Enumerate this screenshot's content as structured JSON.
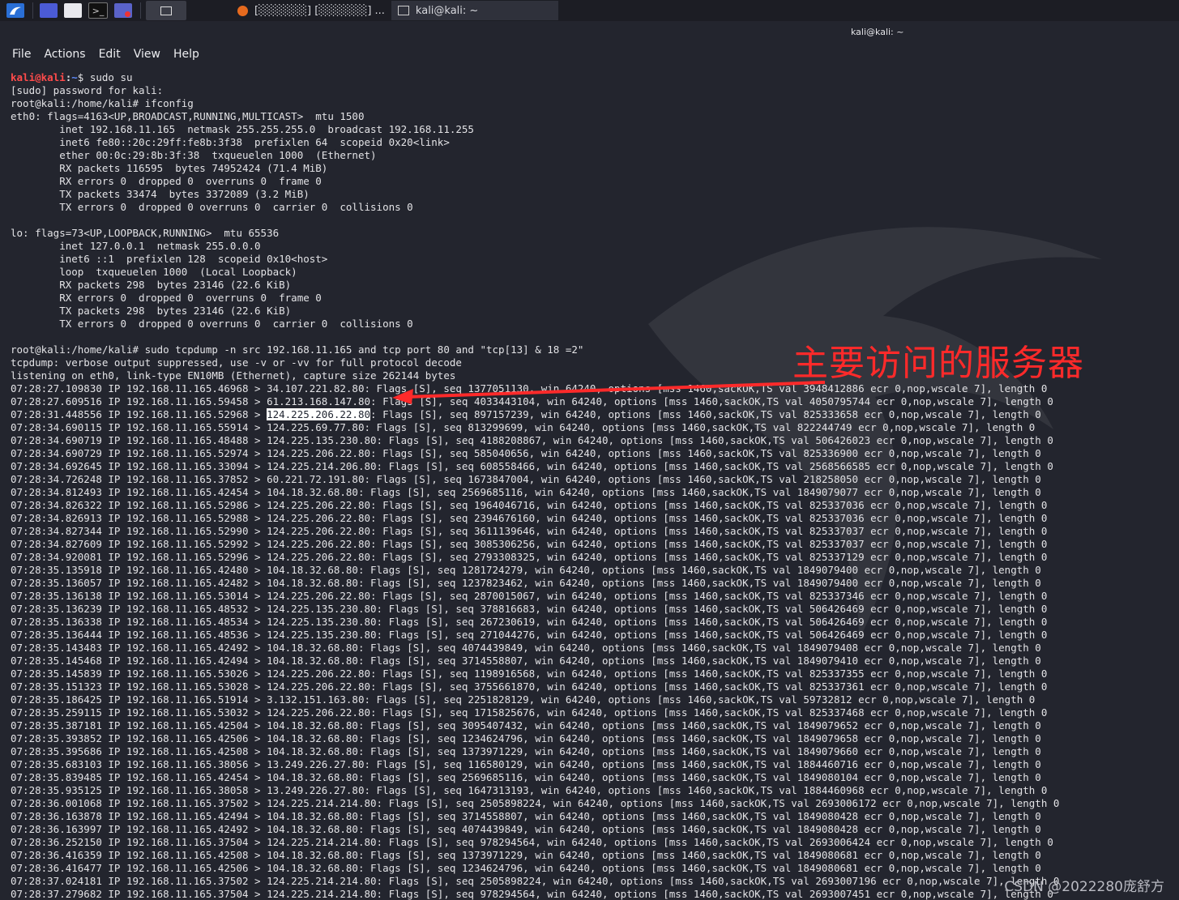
{
  "taskbar": {
    "tasks": [
      {
        "label": "[░░░░░░] [░░░░░░] ..."
      },
      {
        "label": "kali@kali: ~"
      }
    ]
  },
  "window": {
    "title": "kali@kali: ~"
  },
  "menu": [
    "File",
    "Actions",
    "Edit",
    "View",
    "Help"
  ],
  "prompt": {
    "user": "kali@kali",
    "path": "~",
    "command": "sudo su"
  },
  "terminal_lines": [
    "[sudo] password for kali:",
    "root@kali:/home/kali# ifconfig",
    "eth0: flags=4163<UP,BROADCAST,RUNNING,MULTICAST>  mtu 1500",
    "        inet 192.168.11.165  netmask 255.255.255.0  broadcast 192.168.11.255",
    "        inet6 fe80::20c:29ff:fe8b:3f38  prefixlen 64  scopeid 0x20<link>",
    "        ether 00:0c:29:8b:3f:38  txqueuelen 1000  (Ethernet)",
    "        RX packets 116595  bytes 74952424 (71.4 MiB)",
    "        RX errors 0  dropped 0  overruns 0  frame 0",
    "        TX packets 33474  bytes 3372089 (3.2 MiB)",
    "        TX errors 0  dropped 0 overruns 0  carrier 0  collisions 0",
    "",
    "lo: flags=73<UP,LOOPBACK,RUNNING>  mtu 65536",
    "        inet 127.0.0.1  netmask 255.0.0.0",
    "        inet6 ::1  prefixlen 128  scopeid 0x10<host>",
    "        loop  txqueuelen 1000  (Local Loopback)",
    "        RX packets 298  bytes 23146 (22.6 KiB)",
    "        RX errors 0  dropped 0  overruns 0  frame 0",
    "        TX packets 298  bytes 23146 (22.6 KiB)",
    "        TX errors 0  dropped 0 overruns 0  carrier 0  collisions 0",
    "",
    "root@kali:/home/kali# sudo tcpdump -n src 192.168.11.165 and tcp port 80 and \"tcp[13] & 18 =2\"",
    "tcpdump: verbose output suppressed, use -v or -vv for full protocol decode",
    "listening on eth0, link-type EN10MB (Ethernet), capture size 262144 bytes",
    "07:28:27.109830 IP 192.168.11.165.46968 > 34.107.221.82.80: Flags [S], seq 1377051130, win 64240, options [mss 1460,sackOK,TS val 3948412886 ecr 0,nop,wscale 7], length 0",
    "07:28:27.609516 IP 192.168.11.165.59458 > 61.213.168.147.80: Flags [S], seq 4033443104, win 64240, options [mss 1460,sackOK,TS val 4050795744 ecr 0,nop,wscale 7], length 0",
    "07:28:31.448556 IP 192.168.11.165.52968 > 124.225.206.22.80: Flags [S], seq 897157239, win 64240, options [mss 1460,sackOK,TS val 825333658 ecr 0,nop,wscale 7], length 0",
    "07:28:34.690115 IP 192.168.11.165.55914 > 124.225.69.77.80: Flags [S], seq 813299699, win 64240, options [mss 1460,sackOK,TS val 822244749 ecr 0,nop,wscale 7], length 0",
    "07:28:34.690719 IP 192.168.11.165.48488 > 124.225.135.230.80: Flags [S], seq 4188208867, win 64240, options [mss 1460,sackOK,TS val 506426023 ecr 0,nop,wscale 7], length 0",
    "07:28:34.690729 IP 192.168.11.165.52974 > 124.225.206.22.80: Flags [S], seq 585040656, win 64240, options [mss 1460,sackOK,TS val 825336900 ecr 0,nop,wscale 7], length 0",
    "07:28:34.692645 IP 192.168.11.165.33094 > 124.225.214.206.80: Flags [S], seq 608558466, win 64240, options [mss 1460,sackOK,TS val 2568566585 ecr 0,nop,wscale 7], length 0",
    "07:28:34.726248 IP 192.168.11.165.37852 > 60.221.72.191.80: Flags [S], seq 1673847004, win 64240, options [mss 1460,sackOK,TS val 218258050 ecr 0,nop,wscale 7], length 0",
    "07:28:34.812493 IP 192.168.11.165.42454 > 104.18.32.68.80: Flags [S], seq 2569685116, win 64240, options [mss 1460,sackOK,TS val 1849079077 ecr 0,nop,wscale 7], length 0",
    "07:28:34.826322 IP 192.168.11.165.52986 > 124.225.206.22.80: Flags [S], seq 1964046716, win 64240, options [mss 1460,sackOK,TS val 825337036 ecr 0,nop,wscale 7], length 0",
    "07:28:34.826913 IP 192.168.11.165.52988 > 124.225.206.22.80: Flags [S], seq 2394676160, win 64240, options [mss 1460,sackOK,TS val 825337036 ecr 0,nop,wscale 7], length 0",
    "07:28:34.827344 IP 192.168.11.165.52990 > 124.225.206.22.80: Flags [S], seq 3611139646, win 64240, options [mss 1460,sackOK,TS val 825337037 ecr 0,nop,wscale 7], length 0",
    "07:28:34.827609 IP 192.168.11.165.52992 > 124.225.206.22.80: Flags [S], seq 3085306256, win 64240, options [mss 1460,sackOK,TS val 825337037 ecr 0,nop,wscale 7], length 0",
    "07:28:34.920081 IP 192.168.11.165.52996 > 124.225.206.22.80: Flags [S], seq 2793308325, win 64240, options [mss 1460,sackOK,TS val 825337129 ecr 0,nop,wscale 7], length 0",
    "07:28:35.135918 IP 192.168.11.165.42480 > 104.18.32.68.80: Flags [S], seq 1281724279, win 64240, options [mss 1460,sackOK,TS val 1849079400 ecr 0,nop,wscale 7], length 0",
    "07:28:35.136057 IP 192.168.11.165.42482 > 104.18.32.68.80: Flags [S], seq 1237823462, win 64240, options [mss 1460,sackOK,TS val 1849079400 ecr 0,nop,wscale 7], length 0",
    "07:28:35.136138 IP 192.168.11.165.53014 > 124.225.206.22.80: Flags [S], seq 2870015067, win 64240, options [mss 1460,sackOK,TS val 825337346 ecr 0,nop,wscale 7], length 0",
    "07:28:35.136239 IP 192.168.11.165.48532 > 124.225.135.230.80: Flags [S], seq 378816683, win 64240, options [mss 1460,sackOK,TS val 506426469 ecr 0,nop,wscale 7], length 0",
    "07:28:35.136338 IP 192.168.11.165.48534 > 124.225.135.230.80: Flags [S], seq 267230619, win 64240, options [mss 1460,sackOK,TS val 506426469 ecr 0,nop,wscale 7], length 0",
    "07:28:35.136444 IP 192.168.11.165.48536 > 124.225.135.230.80: Flags [S], seq 271044276, win 64240, options [mss 1460,sackOK,TS val 506426469 ecr 0,nop,wscale 7], length 0",
    "07:28:35.143483 IP 192.168.11.165.42492 > 104.18.32.68.80: Flags [S], seq 4074439849, win 64240, options [mss 1460,sackOK,TS val 1849079408 ecr 0,nop,wscale 7], length 0",
    "07:28:35.145468 IP 192.168.11.165.42494 > 104.18.32.68.80: Flags [S], seq 3714558807, win 64240, options [mss 1460,sackOK,TS val 1849079410 ecr 0,nop,wscale 7], length 0",
    "07:28:35.145839 IP 192.168.11.165.53026 > 124.225.206.22.80: Flags [S], seq 1198916568, win 64240, options [mss 1460,sackOK,TS val 825337355 ecr 0,nop,wscale 7], length 0",
    "07:28:35.151323 IP 192.168.11.165.53028 > 124.225.206.22.80: Flags [S], seq 3755661870, win 64240, options [mss 1460,sackOK,TS val 825337361 ecr 0,nop,wscale 7], length 0",
    "07:28:35.186425 IP 192.168.11.165.51914 > 3.132.151.163.80: Flags [S], seq 2251828129, win 64240, options [mss 1460,sackOK,TS val 59732812 ecr 0,nop,wscale 7], length 0",
    "07:28:35.259115 IP 192.168.11.165.53032 > 124.225.206.22.80: Flags [S], seq 1715825676, win 64240, options [mss 1460,sackOK,TS val 825337468 ecr 0,nop,wscale 7], length 0",
    "07:28:35.387181 IP 192.168.11.165.42504 > 104.18.32.68.80: Flags [S], seq 3095407432, win 64240, options [mss 1460,sackOK,TS val 1849079652 ecr 0,nop,wscale 7], length 0",
    "07:28:35.393852 IP 192.168.11.165.42506 > 104.18.32.68.80: Flags [S], seq 1234624796, win 64240, options [mss 1460,sackOK,TS val 1849079658 ecr 0,nop,wscale 7], length 0",
    "07:28:35.395686 IP 192.168.11.165.42508 > 104.18.32.68.80: Flags [S], seq 1373971229, win 64240, options [mss 1460,sackOK,TS val 1849079660 ecr 0,nop,wscale 7], length 0",
    "07:28:35.683103 IP 192.168.11.165.38056 > 13.249.226.27.80: Flags [S], seq 116580129, win 64240, options [mss 1460,sackOK,TS val 1884460716 ecr 0,nop,wscale 7], length 0",
    "07:28:35.839485 IP 192.168.11.165.42454 > 104.18.32.68.80: Flags [S], seq 2569685116, win 64240, options [mss 1460,sackOK,TS val 1849080104 ecr 0,nop,wscale 7], length 0",
    "07:28:35.935125 IP 192.168.11.165.38058 > 13.249.226.27.80: Flags [S], seq 1647313193, win 64240, options [mss 1460,sackOK,TS val 1884460968 ecr 0,nop,wscale 7], length 0",
    "07:28:36.001068 IP 192.168.11.165.37502 > 124.225.214.214.80: Flags [S], seq 2505898224, win 64240, options [mss 1460,sackOK,TS val 2693006172 ecr 0,nop,wscale 7], length 0",
    "07:28:36.163878 IP 192.168.11.165.42494 > 104.18.32.68.80: Flags [S], seq 3714558807, win 64240, options [mss 1460,sackOK,TS val 1849080428 ecr 0,nop,wscale 7], length 0",
    "07:28:36.163997 IP 192.168.11.165.42492 > 104.18.32.68.80: Flags [S], seq 4074439849, win 64240, options [mss 1460,sackOK,TS val 1849080428 ecr 0,nop,wscale 7], length 0",
    "07:28:36.252150 IP 192.168.11.165.37504 > 124.225.214.214.80: Flags [S], seq 978294564, win 64240, options [mss 1460,sackOK,TS val 2693006424 ecr 0,nop,wscale 7], length 0",
    "07:28:36.416359 IP 192.168.11.165.42508 > 104.18.32.68.80: Flags [S], seq 1373971229, win 64240, options [mss 1460,sackOK,TS val 1849080681 ecr 0,nop,wscale 7], length 0",
    "07:28:36.416477 IP 192.168.11.165.42506 > 104.18.32.68.80: Flags [S], seq 1234624796, win 64240, options [mss 1460,sackOK,TS val 1849080681 ecr 0,nop,wscale 7], length 0",
    "07:28:37.024181 IP 192.168.11.165.37502 > 124.225.214.214.80: Flags [S], seq 2505898224, win 64240, options [mss 1460,sackOK,TS val 2693007196 ecr 0,nop,wscale 7], length 0",
    "07:28:37.279682 IP 192.168.11.165.37504 > 124.225.214.214.80: Flags [S], seq 978294564, win 64240, options [mss 1460,sackOK,TS val 2693007451 ecr 0,nop,wscale 7], length 0"
  ],
  "highlight": {
    "line_text": "124.225.206.22.80"
  },
  "annotation": {
    "label": "主要访问的服务器"
  },
  "credit": "CSDN @2022280庞舒方",
  "colors": {
    "background": "#23252e",
    "prompt_user": "#ff4b4b",
    "prompt_path": "#5f8cff",
    "annotation": "#ff2a2a"
  }
}
